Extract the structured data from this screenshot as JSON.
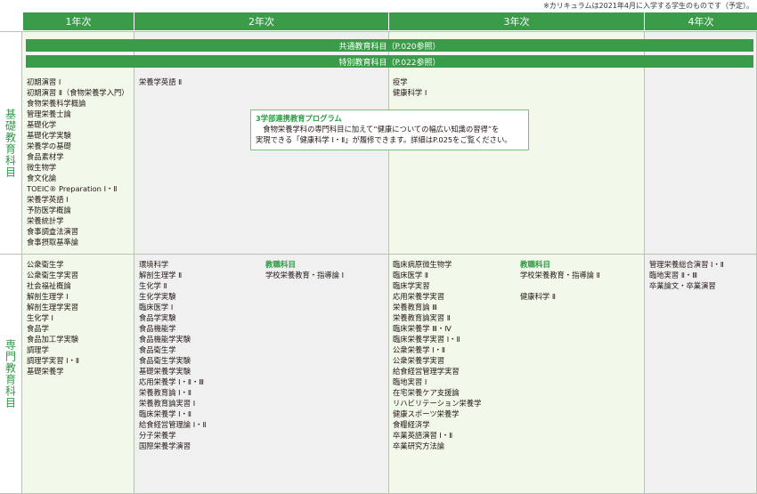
{
  "note": "※カリキュラムは2021年4月に入学する学生のものです（予定）。",
  "headers": [
    "1年次",
    "2年次",
    "3年次",
    "4年次"
  ],
  "rows": {
    "basic": "基礎教育科目",
    "specialized": "専門教育科目"
  },
  "bands": {
    "common": "共通教育科目（P.020参照）",
    "special": "特別教育科目（P.022参照）"
  },
  "callout": {
    "title": "3学部連携教育プログラム",
    "line1": "　食物栄養学科の専門科目に加えて“健康についての幅広い知識の習得”を",
    "line2": "実現できる「健康科学 Ⅰ・Ⅱ」が履修できます。詳細はP.025をご覧ください。"
  },
  "basic": {
    "y1": [
      "初期演習 Ⅰ",
      "初期演習 Ⅱ（食物栄養学入門）",
      "食物栄養科学概論",
      "管理栄養士論",
      "基礎化学",
      "基礎化学実験",
      "栄養学の基礎",
      "食品素材学",
      "微生物学",
      "食文化論",
      "TOEIC® Preparation Ⅰ・Ⅱ",
      "栄養学英語 Ⅰ",
      "予防医学概論",
      "栄養統計学",
      "食事調査法演習",
      "食事摂取基準論"
    ],
    "y2": [
      "栄養学英語 Ⅱ"
    ],
    "y3": [
      "疫学",
      "健康科学 Ⅰ"
    ],
    "y4": []
  },
  "specialized": {
    "y1": [
      "公衆衛生学",
      "公衆衛生学実習",
      "社会福祉概論",
      "解剖生理学 Ⅰ",
      "解剖生理学実習",
      "生化学 Ⅰ",
      "食品学",
      "食品加工学実験",
      "調理学",
      "調理学実習 Ⅰ・Ⅱ",
      "基礎栄養学"
    ],
    "y2": [
      "環境科学",
      "解剖生理学 Ⅱ",
      "生化学 Ⅱ",
      "生化学実験",
      "臨床医学 Ⅰ",
      "食品学実験",
      "食品機能学",
      "食品機能学実験",
      "食品衛生学",
      "食品衛生学実験",
      "基礎栄養学実験",
      "応用栄養学 Ⅰ・Ⅱ・Ⅲ",
      "栄養教育論 Ⅰ・Ⅱ",
      "栄養教育論実習 Ⅰ",
      "臨床栄養学 Ⅰ・Ⅱ",
      "給食経営管理論 Ⅰ・Ⅱ",
      "分子栄養学",
      "国際栄養学演習"
    ],
    "y2_teaching_head": "教職科目",
    "y2_teaching": [
      "学校栄養教育・指導論 Ⅰ"
    ],
    "y3": [
      "臨床病原微生物学",
      "臨床医学 Ⅱ",
      "臨床学実習",
      "応用栄養学実習",
      "栄養教育論 Ⅲ",
      "栄養教育論実習 Ⅱ",
      "臨床栄養学 Ⅲ・Ⅳ",
      "臨床栄養学実習 Ⅰ・Ⅱ",
      "公衆栄養学 Ⅰ・Ⅱ",
      "公衆栄養学実習",
      "給食経営管理学実習",
      "臨地実習 Ⅰ",
      "在宅栄養ケア支援論",
      "リハビリテーション栄養学",
      "健康スポーツ栄養学",
      "食糧経済学",
      "卒業英語演習 Ⅰ・Ⅱ",
      "卒業研究方法論"
    ],
    "y3_teaching_head": "教職科目",
    "y3_teaching": [
      "学校栄養教育・指導論 Ⅱ"
    ],
    "y3_extra": "健康科学 Ⅱ",
    "y4": [
      "管理栄養総合演習 Ⅰ・Ⅱ",
      "臨地実習 Ⅱ・Ⅲ",
      "卒業論文・卒業演習"
    ]
  }
}
